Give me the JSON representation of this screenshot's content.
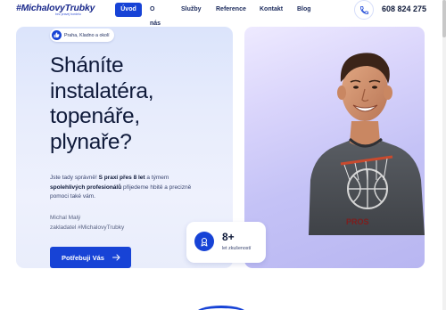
{
  "header": {
    "logo_text": "#MichalovyTrubky",
    "logo_tagline": "bez pravej bordelu",
    "nav": [
      "Úvod",
      "O nás",
      "Služby",
      "Reference",
      "Kontakt",
      "Blog"
    ],
    "phone": "608 824 275"
  },
  "hero": {
    "location": "Praha, Kladno a okolí",
    "headline": [
      "Sháníte",
      "instalatéra,",
      "topenáře,",
      "plynaře?"
    ],
    "desc_1": "Jste tady správně! ",
    "desc_bold_1": "S praxí přes 8 let",
    "desc_2": " a týmem ",
    "desc_bold_2": "spolehlivých profesionálů",
    "desc_3": " přijedeme hbitě a precizně pomoci také vám.",
    "sign_name": "Michal Malý",
    "sign_role": "zakladatel #MichalovyTrubky",
    "cta_label": "Potřebuji Vás"
  },
  "experience": {
    "number": "8+",
    "label": "let zkušeností"
  },
  "colors": {
    "accent": "#1743d6",
    "text": "#0f1a3a"
  }
}
